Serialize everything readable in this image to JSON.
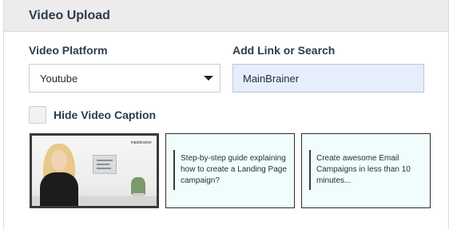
{
  "panel": {
    "title": "Video Upload"
  },
  "platform": {
    "label": "Video Platform",
    "selected": "Youtube"
  },
  "link": {
    "label": "Add Link or Search",
    "value": "MainBrainer"
  },
  "caption": {
    "label": "Hide Video Caption",
    "checked": false
  },
  "thumbnail": {
    "logo_text": "mainbrainer"
  },
  "cards": [
    {
      "text": "Step-by-step guide explaining how to create a Landing Page campaign?"
    },
    {
      "text": "Create awesome Email Campaigns in less than 10 minutes..."
    }
  ],
  "colors": {
    "header_bg": "#ececec",
    "input_bg": "#e6edfb",
    "card_bg": "#f1fcfc"
  }
}
